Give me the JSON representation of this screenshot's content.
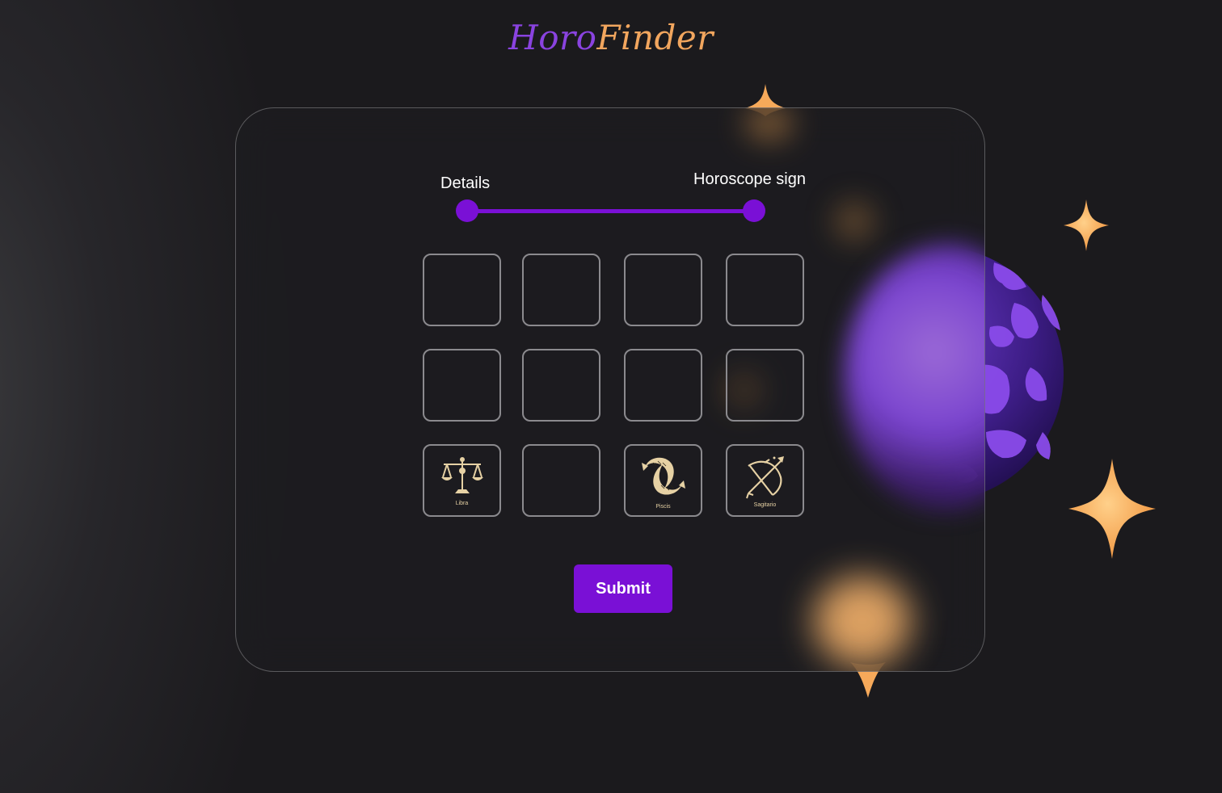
{
  "logo": {
    "part1": "Horo",
    "part2": "Finder"
  },
  "steps": [
    {
      "label": "Details"
    },
    {
      "label": "Horoscope sign"
    }
  ],
  "signs": [
    {
      "name": ""
    },
    {
      "name": ""
    },
    {
      "name": ""
    },
    {
      "name": ""
    },
    {
      "name": ""
    },
    {
      "name": ""
    },
    {
      "name": ""
    },
    {
      "name": ""
    },
    {
      "name": "Libra",
      "icon": "libra-icon"
    },
    {
      "name": ""
    },
    {
      "name": "Piscis",
      "icon": "pisces-icon"
    },
    {
      "name": "Sagitario",
      "icon": "sagittarius-icon"
    }
  ],
  "submit_label": "Submit",
  "colors": {
    "accent": "#7a10d6",
    "logo_purple": "#8a43e0",
    "logo_orange": "#f2a65e",
    "gold": "#e6d1a4",
    "sparkle": "#f6a95a"
  }
}
